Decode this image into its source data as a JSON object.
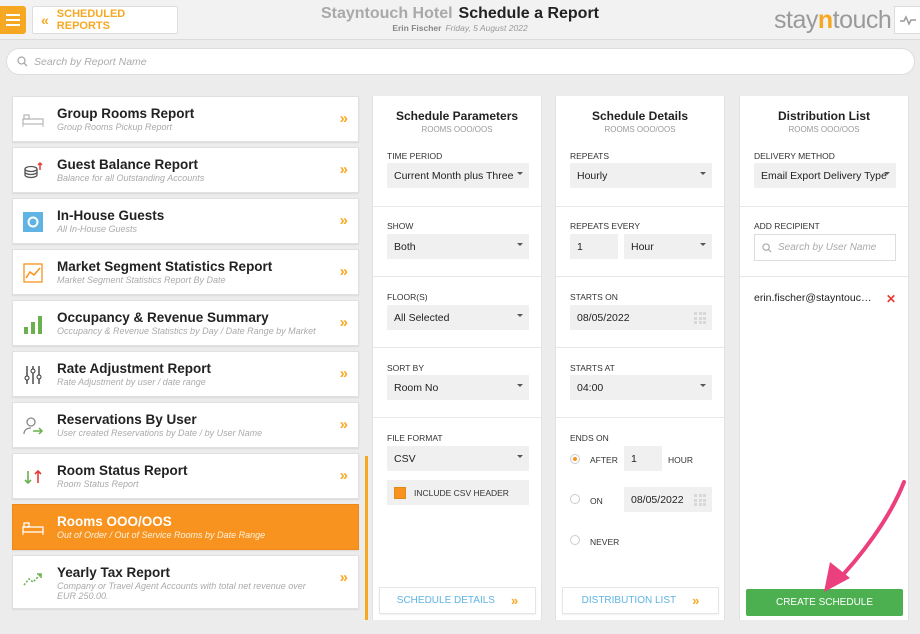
{
  "header": {
    "back_label": "SCHEDULED REPORTS",
    "hotel_name": "Stayntouch Hotel",
    "page_title": "Schedule a Report",
    "user_name": "Erin Fischer",
    "date": "Friday, 5 August 2022",
    "logo_part1": "stay",
    "logo_part2": "n",
    "logo_part3": "touch"
  },
  "search": {
    "placeholder": "Search by Report Name"
  },
  "reports": [
    {
      "name": "Group Rooms Report",
      "desc": "Group Rooms Pickup Report",
      "icon": "bed-icon"
    },
    {
      "name": "Guest Balance Report",
      "desc": "Balance for all Outstanding Accounts",
      "icon": "coins-icon"
    },
    {
      "name": "In-House Guests",
      "desc": "All In-House Guests",
      "icon": "in-house-icon"
    },
    {
      "name": "Market Segment Statistics Report",
      "desc": "Market Segment Statistics Report By Date",
      "icon": "line-chart-icon"
    },
    {
      "name": "Occupancy & Revenue Summary",
      "desc": "Occupancy & Revenue Statistics by Day / Date Range by Market",
      "icon": "bar-chart-icon"
    },
    {
      "name": "Rate Adjustment Report",
      "desc": "Rate Adjustment by user / date range",
      "icon": "sliders-icon"
    },
    {
      "name": "Reservations By User",
      "desc": "User created Reservations by Date / by User Name",
      "icon": "user-arrow-icon"
    },
    {
      "name": "Room Status Report",
      "desc": "Room Status Report",
      "icon": "up-down-arrows-icon"
    },
    {
      "name": "Rooms OOO/OOS",
      "desc": "Out of Order / Out of Service Rooms by Date Range",
      "icon": "bed-icon",
      "active": true
    },
    {
      "name": "Yearly Tax Report",
      "desc": "Company or Travel Agent Accounts with total net revenue over EUR 250.00.",
      "icon": "trend-icon"
    }
  ],
  "params": {
    "title": "Schedule Parameters",
    "subtitle": "ROOMS OOO/OOS",
    "time_period_label": "TIME PERIOD",
    "time_period_value": "Current Month plus Three",
    "show_label": "SHOW",
    "show_value": "Both",
    "floors_label": "FLOOR(S)",
    "floors_value": "All Selected",
    "sort_label": "SORT BY",
    "sort_value": "Room No",
    "format_label": "FILE FORMAT",
    "format_value": "CSV",
    "csv_header_label": "INCLUDE CSV HEADER",
    "footer_label": "SCHEDULE DETAILS"
  },
  "details": {
    "title": "Schedule Details",
    "subtitle": "ROOMS OOO/OOS",
    "repeats_label": "REPEATS",
    "repeats_value": "Hourly",
    "every_label": "REPEATS EVERY",
    "every_value": "1",
    "every_unit": "Hour",
    "starts_on_label": "STARTS ON",
    "starts_on_value": "08/05/2022",
    "starts_at_label": "STARTS AT",
    "starts_at_value": "04:00",
    "ends_on_label": "ENDS ON",
    "after_label": "AFTER",
    "after_value": "1",
    "after_unit": "HOUR",
    "on_label": "ON",
    "on_value": "08/05/2022",
    "never_label": "NEVER",
    "footer_label": "DISTRIBUTION LIST"
  },
  "distribution": {
    "title": "Distribution List",
    "subtitle": "ROOMS OOO/OOS",
    "method_label": "DELIVERY METHOD",
    "method_value": "Email Export Delivery Type",
    "recipient_label": "ADD RECIPIENT",
    "recipient_placeholder": "Search by User Name",
    "recipient_email": "erin.fischer@stayntouch.com",
    "create_label": "CREATE SCHEDULE"
  },
  "colors": {
    "accent": "#f7931e",
    "link": "#5fb4e3",
    "create": "#4caf50",
    "arrow": "#ec3f7d",
    "delete": "#e53935"
  }
}
